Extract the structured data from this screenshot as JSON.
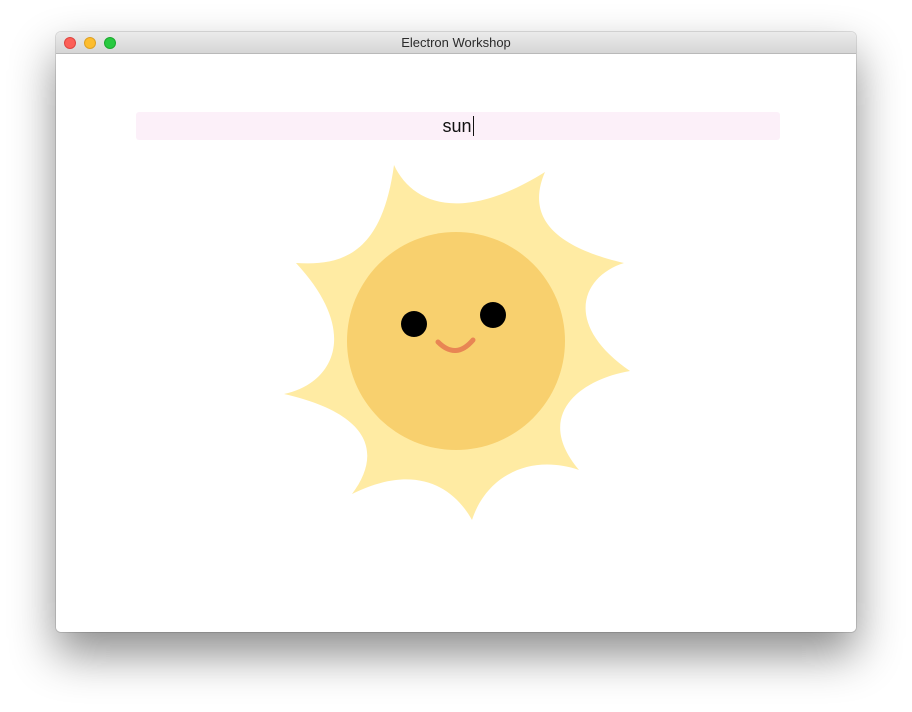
{
  "window": {
    "title": "Electron Workshop",
    "controls": [
      "close",
      "minimize",
      "zoom"
    ]
  },
  "search": {
    "value": "sun"
  },
  "result": {
    "icon": "smiling-sun-icon",
    "colors": {
      "rays": "#ffeba3",
      "face": "#f8d06e",
      "eyes": "#000000",
      "smile": "#e88554"
    }
  }
}
